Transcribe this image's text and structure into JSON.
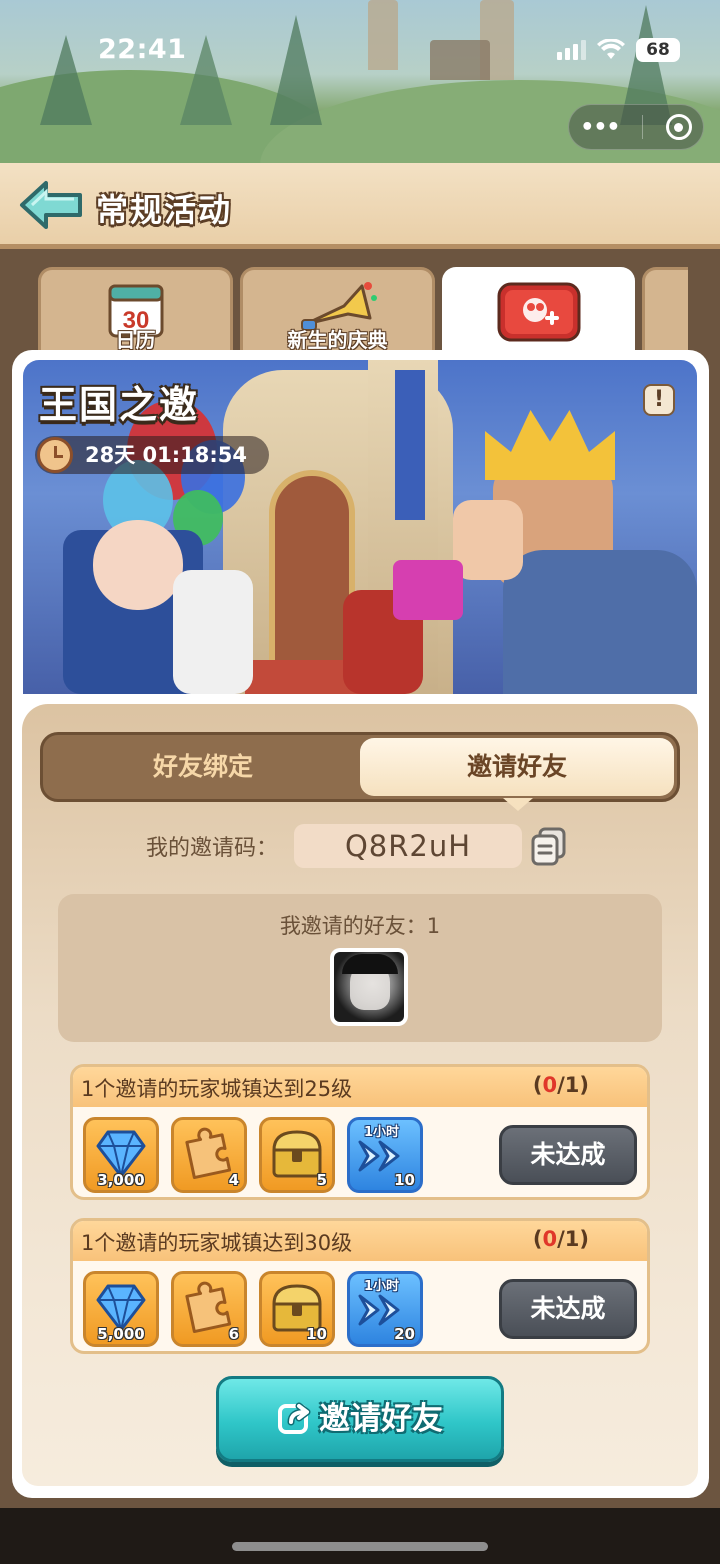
{
  "status_bar": {
    "time": "22:41",
    "battery": "68"
  },
  "header": {
    "title": "常规活动"
  },
  "tabs": [
    {
      "label": "日历",
      "badge": "30"
    },
    {
      "label": "新生的庆典"
    },
    {
      "label": ""
    }
  ],
  "event": {
    "title": "王国之邀",
    "timer": "28天 01:18:54",
    "info": "!"
  },
  "segment": {
    "left": "好友绑定",
    "right": "邀请好友"
  },
  "invite_code": {
    "label": "我的邀请码：",
    "value": "Q8R2uH"
  },
  "friends": {
    "label": "我邀请的好友：1"
  },
  "tasks": [
    {
      "text": "1个邀请的玩家城镇达到25级",
      "progress_open": "(",
      "progress_current": "0",
      "progress_rest": "/1)",
      "rewards": [
        {
          "icon": "diamond-icon",
          "count": "3,000"
        },
        {
          "icon": "puzzle-icon",
          "count": "4"
        },
        {
          "icon": "treasure-chest-icon",
          "count": "5"
        },
        {
          "icon": "speedup-icon",
          "tag": "1小时",
          "count": "10"
        }
      ],
      "status": "未达成"
    },
    {
      "text": "1个邀请的玩家城镇达到30级",
      "progress_open": "(",
      "progress_current": "0",
      "progress_rest": "/1)",
      "rewards": [
        {
          "icon": "diamond-icon",
          "count": "5,000"
        },
        {
          "icon": "puzzle-icon",
          "count": "6"
        },
        {
          "icon": "treasure-chest-icon",
          "count": "10"
        },
        {
          "icon": "speedup-icon",
          "tag": "1小时",
          "count": "20"
        }
      ],
      "status": "未达成"
    }
  ],
  "invite_button": {
    "label": "邀请好友"
  },
  "colors": {
    "accent_teal": "#2fc6c8",
    "progress_red": "#e0372a",
    "panel_beige": "#ecdcc6",
    "header_brown": "#5c3e26"
  }
}
